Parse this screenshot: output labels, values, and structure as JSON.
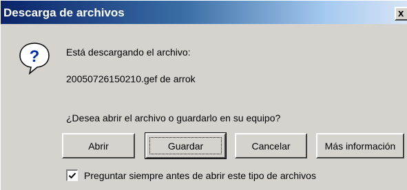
{
  "window": {
    "title": "Descarga de archivos",
    "close_label": "x"
  },
  "message": {
    "line1": "Está descargando el archivo:",
    "filename": "20050726150210.gef de arrok",
    "question": "¿Desea abrir el archivo o guardarlo en su equipo?"
  },
  "buttons": {
    "open": "Abrir",
    "save": "Guardar",
    "cancel": "Cancelar",
    "more_info": "Más información"
  },
  "checkbox": {
    "label": "Preguntar siempre antes de abrir este tipo de archivos",
    "checked": true
  },
  "icons": {
    "dialog_icon": "question-mark-icon"
  },
  "colors": {
    "titlebar_start": "#0a246a",
    "titlebar_end": "#d6e4f5",
    "dialog_face": "#d6d3ce"
  }
}
